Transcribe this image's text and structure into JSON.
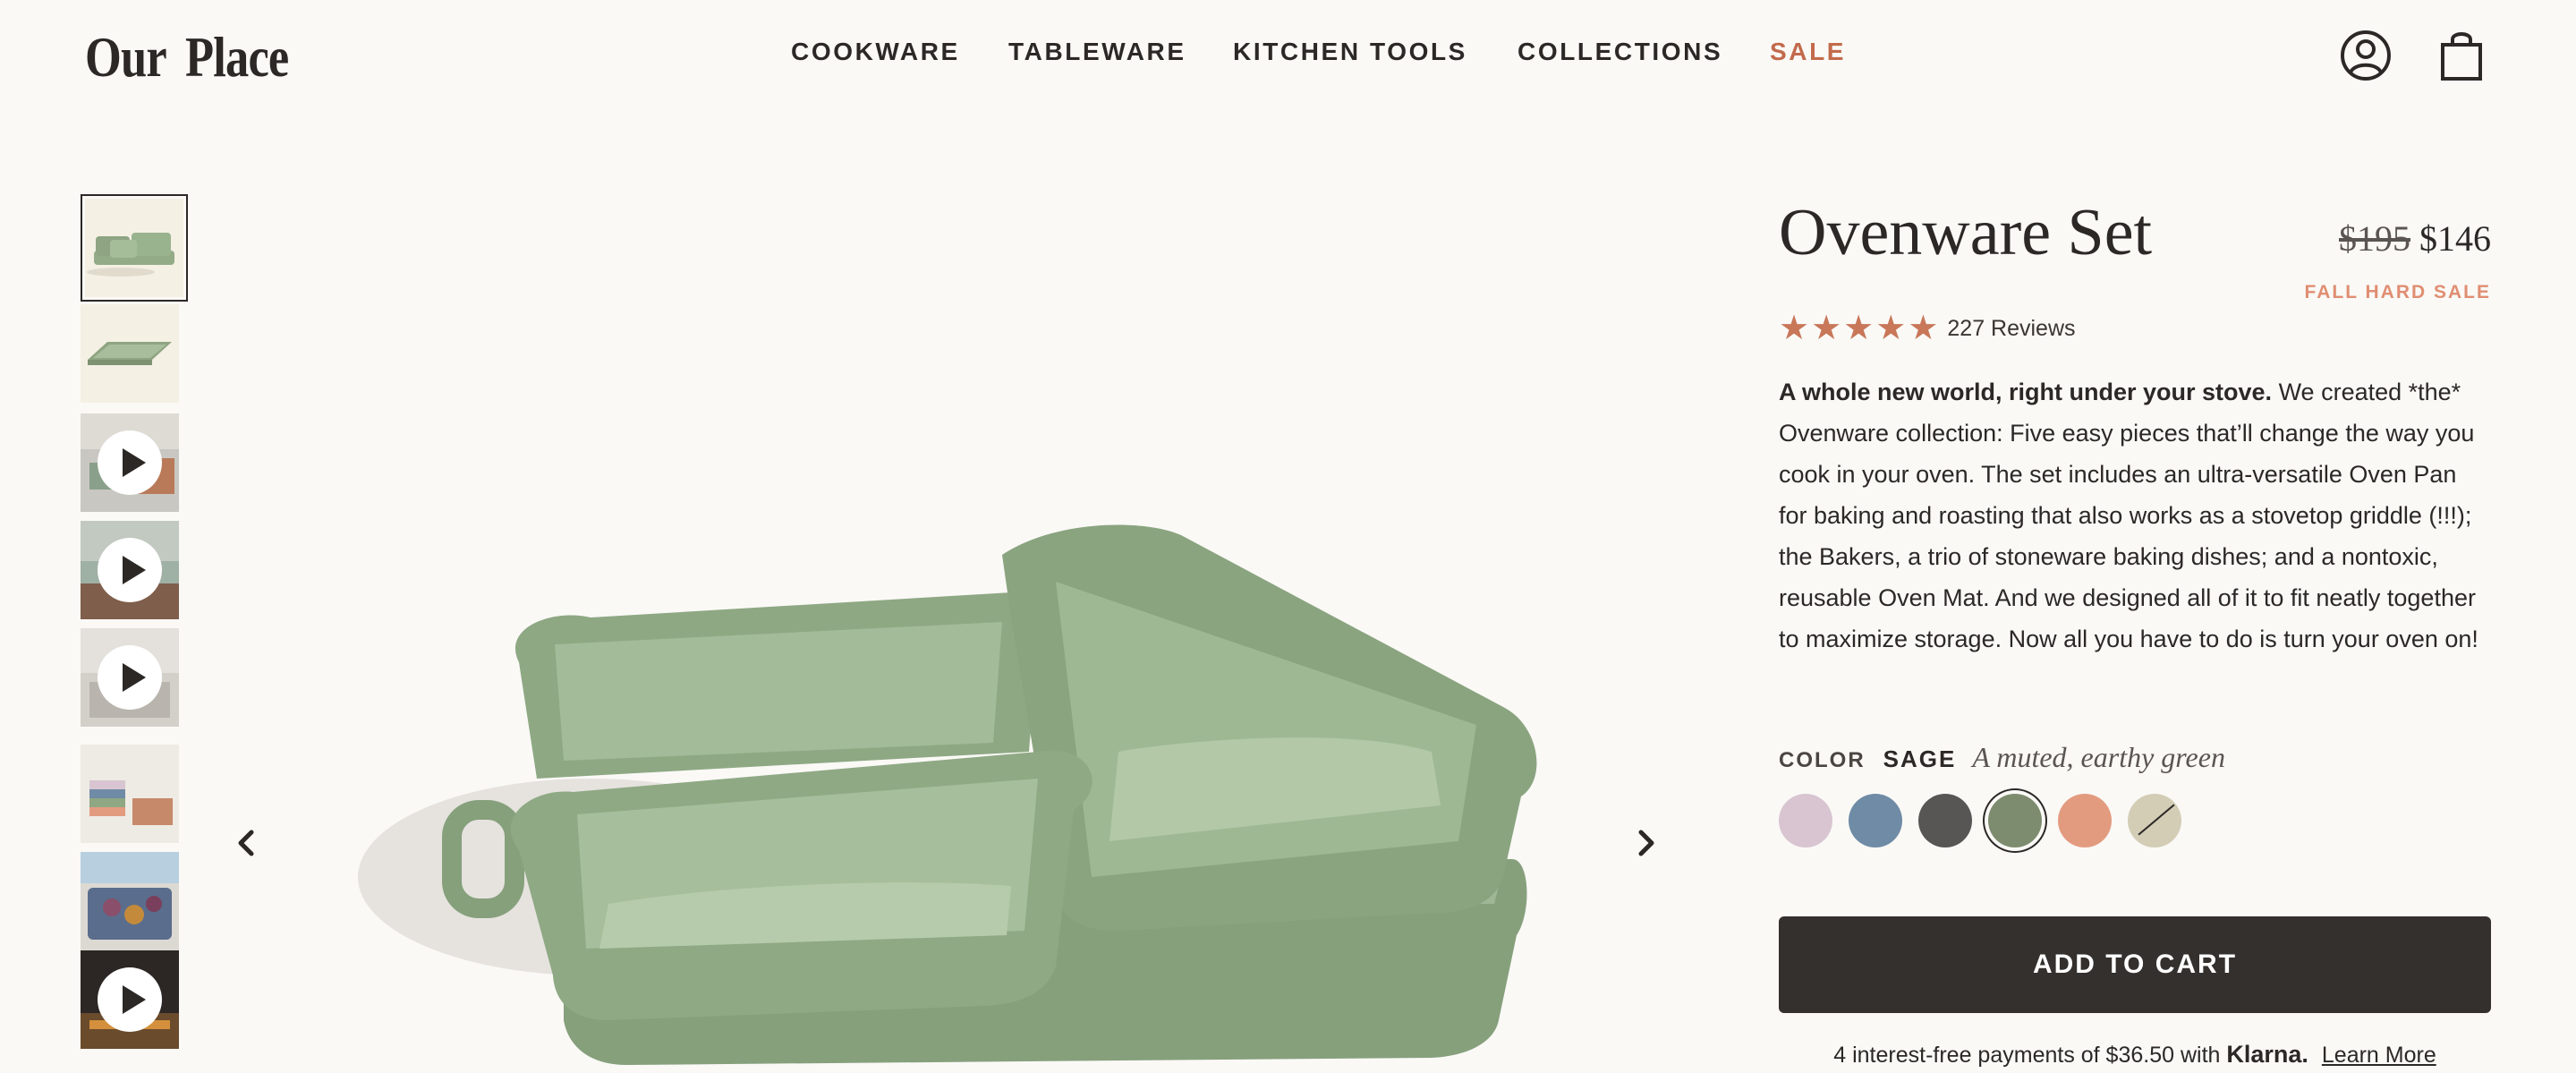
{
  "brand": {
    "logo": "Our Place"
  },
  "nav": {
    "items": [
      {
        "label": "COOKWARE"
      },
      {
        "label": "TABLEWARE"
      },
      {
        "label": "KITCHEN TOOLS"
      },
      {
        "label": "COLLECTIONS"
      },
      {
        "label": "SALE"
      }
    ]
  },
  "header_icons": [
    "account-icon",
    "bag-icon"
  ],
  "gallery": {
    "thumbnails": [
      {
        "kind": "image",
        "active": true
      },
      {
        "kind": "image",
        "active": false
      },
      {
        "kind": "video",
        "active": false
      },
      {
        "kind": "video",
        "active": false
      },
      {
        "kind": "video",
        "active": false
      },
      {
        "kind": "image",
        "active": false
      },
      {
        "kind": "image",
        "active": false
      },
      {
        "kind": "video",
        "active": false
      }
    ],
    "prev_icon": "chevron-left-icon",
    "next_icon": "chevron-right-icon"
  },
  "product": {
    "title": "Ovenware Set",
    "price_old": "$195",
    "price_new": "$146",
    "sale_label": "FALL HARD SALE",
    "rating": {
      "stars": 5,
      "reviews": "227 Reviews"
    },
    "description_lead": "A whole new world, right under your stove.",
    "description_body": " We created *the* Ovenware collection: Five easy pieces that’ll change the way you cook in your oven. The set includes an ultra-versatile Oven Pan for baking and roasting that also works as a stovetop griddle (!!!); the Bakers, a trio of stoneware baking dishes; and a nontoxic, reusable Oven Mat. And we designed all of it to fit neatly together to maximize storage. Now all you have to do is turn your oven on!",
    "color": {
      "label": "COLOR",
      "selected_name": "SAGE",
      "selected_desc": "A muted, earthy green",
      "swatches": [
        {
          "hex": "#d8c5d1"
        },
        {
          "hex": "#6f8ba6"
        },
        {
          "hex": "#575654"
        },
        {
          "hex": "#7d8c6e",
          "selected": true
        },
        {
          "hex": "#e39b80"
        },
        {
          "hex": "#d3cdb6",
          "sold_out": true
        }
      ]
    },
    "add_to_cart": "ADD TO CART",
    "financing": {
      "text": "4 interest-free payments of $36.50 with",
      "brand": "Klarna.",
      "link": "Learn More"
    }
  },
  "colors": {
    "accent": "#c36a4c",
    "button": "#34302d",
    "background": "#faf9f6",
    "sage": "#8fa783"
  }
}
